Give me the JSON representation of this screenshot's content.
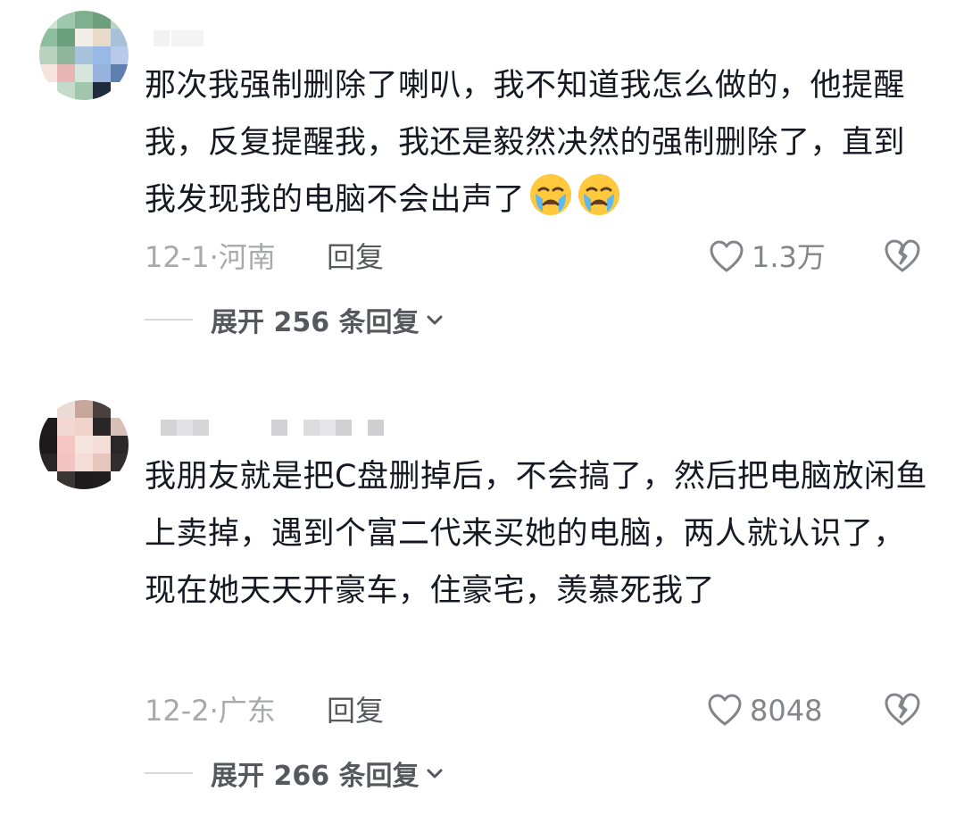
{
  "comments": [
    {
      "text": "那次我强制删除了喇叭，我不知道我怎么做的，他提醒我，反复提醒我，我还是毅然决然的强制删除了，直到我发现我的电脑不会出声了",
      "emoji": [
        "crying-face",
        "crying-face"
      ],
      "date_location": "12-1·河南",
      "reply_label": "回复",
      "likes": "1.3万",
      "expand_label": "展开 256 条回复",
      "avatar_icon": "pixelated-avatar"
    },
    {
      "text": "我朋友就是把C盘删掉后，不会搞了，然后把电脑放闲鱼上卖掉，遇到个富二代来买她的电脑，两人就认识了，现在她天天开豪车，住豪宅，羡慕死我了",
      "date_location": "12-2·广东",
      "reply_label": "回复",
      "likes": "8048",
      "expand_label": "展开 266 条回复",
      "avatar_icon": "pixelated-avatar"
    }
  ],
  "icons": {
    "like": "heart-outline-icon",
    "dislike": "broken-heart-icon",
    "expand": "chevron-down-icon"
  },
  "colors": {
    "text": "#161823",
    "meta": "#a8a9ad",
    "reply": "#57585d",
    "emoji": "#ffc83d"
  }
}
